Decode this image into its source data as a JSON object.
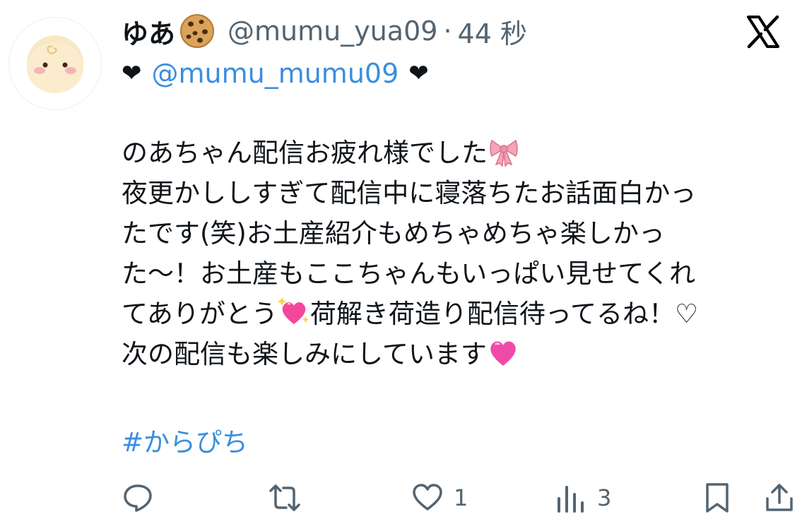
{
  "tweet": {
    "display_name": "ゆあ",
    "handle": "@mumu_yua09",
    "separator": "·",
    "time": "44 秒",
    "mention": "@mumu_mumu09",
    "body_lines": [
      "のあちゃん配信お疲れ様でした",
      "夜更かししすぎて配信中に寝落ちたお話面白かっ",
      "たです(笑)お土産紹介もめちゃめちゃ楽しかっ",
      "た〜！お土産もここちゃんもいっぱい見せてくれ",
      "てありがとう",
      "荷解き荷造り配信待ってるね！♡",
      "次の配信も楽しみにしています"
    ],
    "hashtag": "#からぴち"
  },
  "actions": {
    "reply_count": "",
    "retweet_count": "",
    "like_count": "1",
    "views_count": "3"
  },
  "icons": {
    "cookie": "cookie-emoji",
    "ribbon": "ribbon-emoji",
    "sparkling_heart": "sparkling-heart-emoji",
    "pink_heart": "pink-heart-emoji",
    "x_logo": "x-logo-icon"
  },
  "colors": {
    "link": "#3a8ee0",
    "secondary_text": "#536471",
    "primary_text": "#0f1419"
  }
}
